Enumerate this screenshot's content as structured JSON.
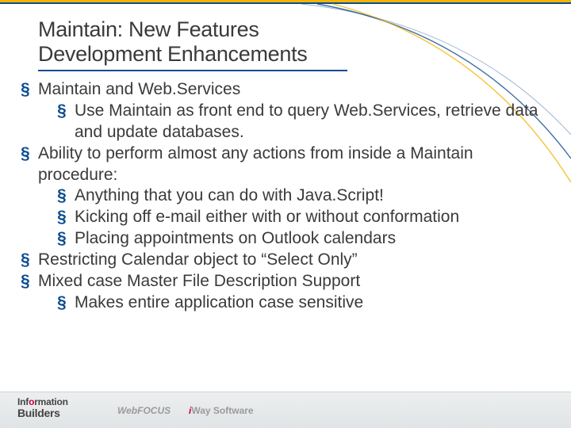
{
  "title": {
    "line1": "Maintain: New Features",
    "line2": "Development Enhancements"
  },
  "bullets": [
    {
      "text": "Maintain and Web.Services",
      "children": [
        {
          "text": "Use Maintain as front end to query Web.Services, retrieve data and update databases."
        }
      ]
    },
    {
      "text": "Ability to perform almost any actions from inside a Maintain procedure:",
      "children": [
        {
          "text": "Anything that you can do with Java.Script!"
        },
        {
          "text": "Kicking off e-mail either with or without conformation"
        },
        {
          "text": "Placing appointments on Outlook calendars"
        }
      ]
    },
    {
      "text": "Restricting Calendar object to “Select Only”"
    },
    {
      "text": "Mixed case Master File Description Support",
      "children": [
        {
          "text": "Makes entire application case sensitive"
        }
      ]
    }
  ],
  "footer": {
    "ib_line1_pre": "Inf",
    "ib_line1_red": "o",
    "ib_line1_post": "rmation",
    "ib_line2": "Builders",
    "webfocus_prefix": "Web",
    "webfocus_bold": "FOCUS",
    "iway_i": "i",
    "iway_rest": "Way Software"
  },
  "colors": {
    "accent_blue": "#0b4c8f",
    "accent_gold": "#f3b400",
    "body_text": "#3a3a3a",
    "footer_red": "#c03"
  }
}
